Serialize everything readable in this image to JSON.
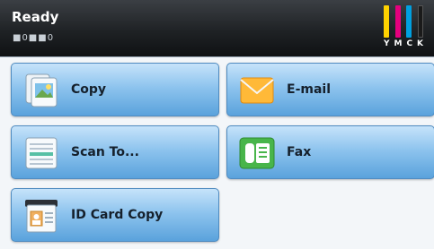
{
  "status": {
    "title": "Ready",
    "sub": "■0■■0"
  },
  "toner": {
    "labels": [
      "Y",
      "M",
      "C",
      "K"
    ],
    "colors": [
      "#ffd200",
      "#e5007e",
      "#00a0e0",
      "#1a1a1a"
    ]
  },
  "tiles": [
    {
      "label": "Copy",
      "icon": "copy-icon"
    },
    {
      "label": "E-mail",
      "icon": "email-icon"
    },
    {
      "label": "Scan To...",
      "icon": "scan-icon"
    },
    {
      "label": "Fax",
      "icon": "fax-icon"
    },
    {
      "label": "ID Card Copy",
      "icon": "id-card-icon"
    }
  ]
}
